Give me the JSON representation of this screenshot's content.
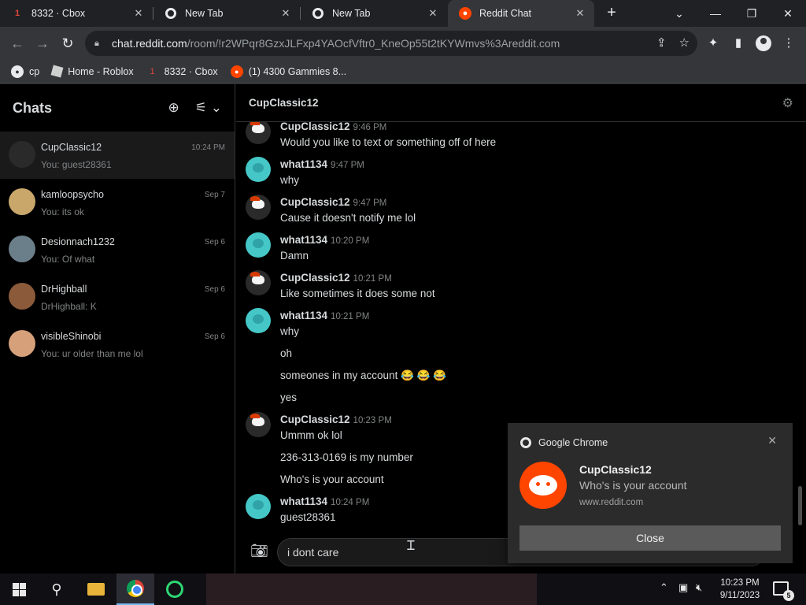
{
  "browser": {
    "tabs": [
      {
        "title": "8332 · Cbox",
        "icon": "roblox-icon",
        "badge": "1"
      },
      {
        "title": "New Tab",
        "icon": "chrome-icon"
      },
      {
        "title": "New Tab",
        "icon": "chrome-icon"
      },
      {
        "title": "Reddit Chat",
        "icon": "reddit-icon"
      }
    ],
    "url_host": "chat.reddit.com",
    "url_path": "/room/!r2WPqr8GzxJLFxp4YAOcfVftr0_KneOp55t2tKYWmvs%3Areddit.com",
    "bookmarks": [
      {
        "label": "cp",
        "icon": "github-icon"
      },
      {
        "label": "Home - Roblox",
        "icon": "roblox-icon"
      },
      {
        "label": "8332 · Cbox",
        "icon": "cbox-icon",
        "badge": "1"
      },
      {
        "label": "(1) 4300 Gammies 8...",
        "icon": "reddit-icon"
      }
    ]
  },
  "sidebar": {
    "title": "Chats",
    "chats": [
      {
        "name": "CupClassic12",
        "preview": "You: guest28361",
        "time": "10:24 PM",
        "avatar_color": "#2a2a2a"
      },
      {
        "name": "kamloopsycho",
        "preview": "You: its ok",
        "time": "Sep 7",
        "avatar_color": "#c9a76b"
      },
      {
        "name": "Desionnach1232",
        "preview": "You: Of what",
        "time": "Sep 6",
        "avatar_color": "#6b7f8a"
      },
      {
        "name": "DrHighball",
        "preview": "DrHighball: K",
        "time": "Sep 6",
        "avatar_color": "#8a5a3a"
      },
      {
        "name": "visibleShinobi",
        "preview": "You: ur older than me lol",
        "time": "Sep 6",
        "avatar_color": "#d6a07a"
      }
    ]
  },
  "chat": {
    "title": "CupClassic12",
    "messages": [
      {
        "author": "CupClassic12",
        "time": "9:46 PM",
        "lines": [
          "Would you like to text or something off of here"
        ]
      },
      {
        "author": "what1134",
        "time": "9:47 PM",
        "lines": [
          "why"
        ]
      },
      {
        "author": "CupClassic12",
        "time": "9:47 PM",
        "lines": [
          "Cause it doesn't notify me lol"
        ]
      },
      {
        "author": "what1134",
        "time": "10:20 PM",
        "lines": [
          "Damn"
        ]
      },
      {
        "author": "CupClassic12",
        "time": "10:21 PM",
        "lines": [
          "Like sometimes it does some not"
        ]
      },
      {
        "author": "what1134",
        "time": "10:21 PM",
        "lines": [
          "why",
          "oh",
          "someones in my account 😂 😂 😂",
          "yes"
        ]
      },
      {
        "author": "CupClassic12",
        "time": "10:23 PM",
        "lines": [
          "Ummm ok lol",
          "236-313-0169 is my number",
          "Who's is your account"
        ]
      },
      {
        "author": "what1134",
        "time": "10:24 PM",
        "lines": [
          "guest28361"
        ]
      }
    ],
    "composer_value": "i dont care"
  },
  "toast": {
    "app": "Google Chrome",
    "title": "CupClassic12",
    "body": "Who's is your account",
    "url": "www.reddit.com",
    "button": "Close"
  },
  "taskbar": {
    "time": "10:23 PM",
    "date": "9/11/2023",
    "notification_count": "5"
  }
}
